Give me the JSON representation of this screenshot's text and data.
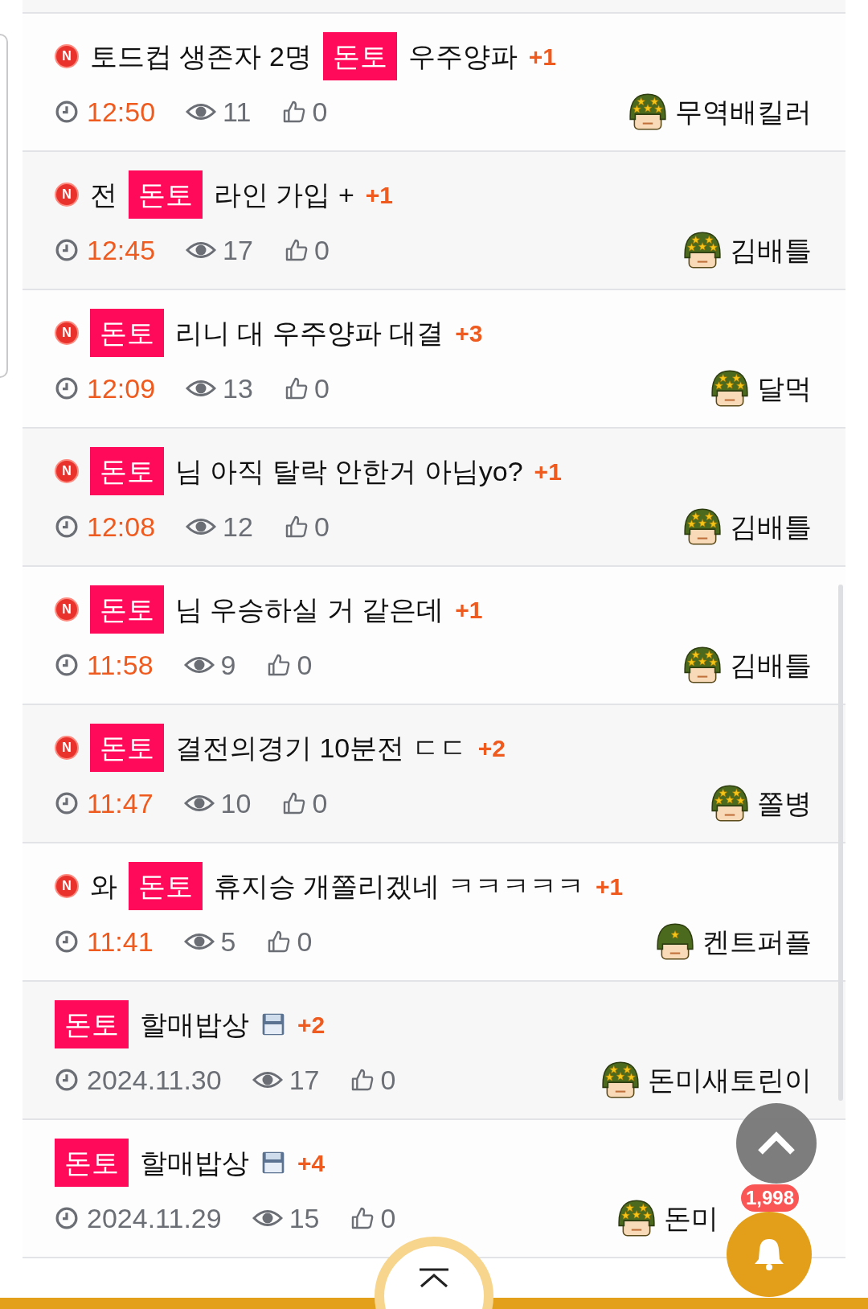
{
  "posts": [
    {
      "new_mark": "N",
      "title": [
        {
          "kind": "text",
          "text": "토드컵 생존자 2명"
        },
        {
          "kind": "tag",
          "text": "돈토"
        },
        {
          "kind": "text",
          "text": "우주양파"
        }
      ],
      "attachment": false,
      "comments": "+1",
      "time": "12:50",
      "time_highlighted": true,
      "views": "11",
      "likes": "0",
      "avatar": {
        "kind": "four-star"
      },
      "author": "무역배킬러"
    },
    {
      "new_mark": "N",
      "title": [
        {
          "kind": "text",
          "text": "전"
        },
        {
          "kind": "tag",
          "text": "돈토"
        },
        {
          "kind": "text",
          "text": "라인 가입 +"
        }
      ],
      "attachment": false,
      "comments": "+1",
      "time": "12:45",
      "time_highlighted": true,
      "views": "17",
      "likes": "0",
      "avatar": {
        "kind": "four-star"
      },
      "author": "김배틀"
    },
    {
      "new_mark": "N",
      "title": [
        {
          "kind": "tag",
          "text": "돈토"
        },
        {
          "kind": "text",
          "text": "리니 대 우주양파 대결"
        }
      ],
      "attachment": false,
      "comments": "+3",
      "time": "12:09",
      "time_highlighted": true,
      "views": "13",
      "likes": "0",
      "avatar": {
        "kind": "four-star"
      },
      "author": "달먹"
    },
    {
      "new_mark": "N",
      "title": [
        {
          "kind": "tag",
          "text": "돈토"
        },
        {
          "kind": "text",
          "text": "님 아직 탈락 안한거 아님yo?"
        }
      ],
      "attachment": false,
      "comments": "+1",
      "time": "12:08",
      "time_highlighted": true,
      "views": "12",
      "likes": "0",
      "avatar": {
        "kind": "four-star"
      },
      "author": "김배틀"
    },
    {
      "new_mark": "N",
      "title": [
        {
          "kind": "tag",
          "text": "돈토"
        },
        {
          "kind": "text",
          "text": "님 우승하실 거 같은데"
        }
      ],
      "attachment": false,
      "comments": "+1",
      "time": "11:58",
      "time_highlighted": true,
      "views": "9",
      "likes": "0",
      "avatar": {
        "kind": "four-star"
      },
      "author": "김배틀"
    },
    {
      "new_mark": "N",
      "title": [
        {
          "kind": "tag",
          "text": "돈토"
        },
        {
          "kind": "text",
          "text": "결전의경기 10분전 ㄷㄷ"
        }
      ],
      "attachment": false,
      "comments": "+2",
      "time": "11:47",
      "time_highlighted": true,
      "views": "10",
      "likes": "0",
      "avatar": {
        "kind": "four-star"
      },
      "author": "쫄병"
    },
    {
      "new_mark": "N",
      "title": [
        {
          "kind": "text",
          "text": "와"
        },
        {
          "kind": "tag",
          "text": "돈토"
        },
        {
          "kind": "text",
          "text": "휴지승 개쫄리겠네 ㅋㅋㅋㅋㅋ"
        }
      ],
      "attachment": false,
      "comments": "+1",
      "time": "11:41",
      "time_highlighted": true,
      "views": "5",
      "likes": "0",
      "avatar": {
        "kind": "one-star"
      },
      "author": "켄트퍼플"
    },
    {
      "title": [
        {
          "kind": "tag",
          "text": "돈토"
        },
        {
          "kind": "text",
          "text": "할매밥상"
        }
      ],
      "attachment": true,
      "comments": "+2",
      "time": "2024.11.30",
      "time_highlighted": false,
      "views": "17",
      "likes": "0",
      "avatar": {
        "kind": "four-star"
      },
      "author": "돈미새토린이"
    },
    {
      "title": [
        {
          "kind": "tag",
          "text": "돈토"
        },
        {
          "kind": "text",
          "text": "할매밥상"
        }
      ],
      "attachment": true,
      "comments": "+4",
      "time": "2024.11.29",
      "time_highlighted": false,
      "views": "15",
      "likes": "0",
      "avatar": {
        "kind": "four-star"
      },
      "author": "돈미"
    }
  ],
  "notification_count": "1,998"
}
